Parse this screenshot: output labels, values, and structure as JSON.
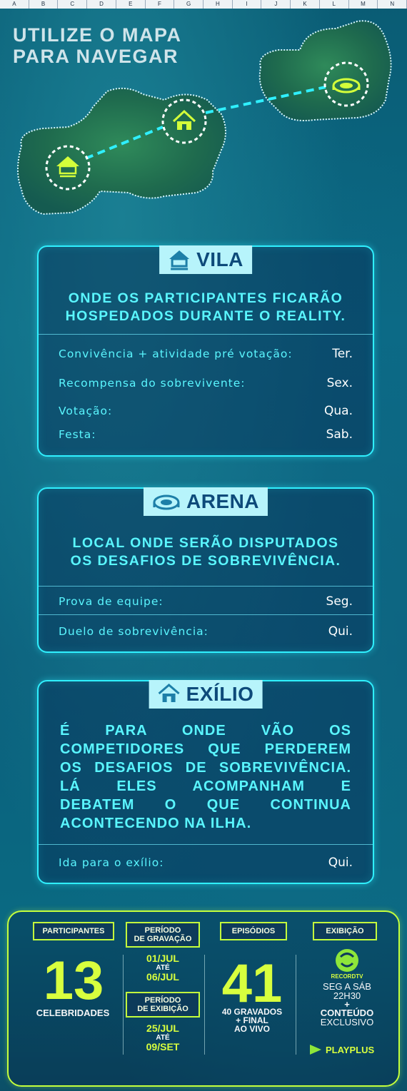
{
  "ruler": [
    "A",
    "B",
    "C",
    "D",
    "E",
    "F",
    "G",
    "H",
    "I",
    "J",
    "K",
    "L",
    "M",
    "N"
  ],
  "map_title": {
    "line1": "UTILIZE O MAPA",
    "line2": "PARA NAVEGAR"
  },
  "vila": {
    "tag": "VILA",
    "description": [
      "ONDE OS PARTICIPANTES FICARÃO",
      "HOSPEDADOS DURANTE O REALITY."
    ],
    "schedule": [
      {
        "label": "Convivência + atividade pré votação:",
        "day": "Ter."
      },
      {
        "label": "Recompensa do sobrevivente:",
        "day": "Sex."
      },
      {
        "label": "Votação:",
        "day": "Qua."
      },
      {
        "label": "Festa:",
        "day": "Sab."
      }
    ]
  },
  "arena": {
    "tag": "ARENA",
    "description": [
      "LOCAL ONDE SERÃO DISPUTADOS",
      "OS DESAFIOS DE SOBREVIVÊNCIA."
    ],
    "schedule": [
      {
        "label": "Prova de equipe:",
        "day": "Seg."
      },
      {
        "label": "Duelo de sobrevivência:",
        "day": "Qui."
      }
    ]
  },
  "exilio": {
    "tag": "EXÍLIO",
    "description": [
      "É PARA ONDE VÃO OS",
      "COMPETIDORES QUE PERDEREM",
      "OS DESAFIOS DE SOBREVIVÊNCIA.",
      "LÁ ELES ACOMPANHAM E",
      "DEBATEM O QUE CONTINUA",
      "ACONTECENDO NA ILHA."
    ],
    "schedule": [
      {
        "label": "Ida para o exílio:",
        "day": "Qui."
      }
    ]
  },
  "stats": {
    "participantes": {
      "badge": "PARTICIPANTES",
      "number": "13",
      "caption": "CELEBRIDADES"
    },
    "gravacao": {
      "badge_line1": "PERÍODO",
      "badge_line2": "DE GRAVAÇÃO",
      "start": "01/JUL",
      "ate": "ATÉ",
      "end": "06/JUL"
    },
    "exibicao_periodo": {
      "badge_line1": "PERÍODO",
      "badge_line2": "DE EXIBIÇÃO",
      "start": "25/JUL",
      "ate": "ATÉ",
      "end": "09/SET"
    },
    "episodios": {
      "badge": "EPISÓDIOS",
      "number": "41",
      "caption1": "40 GRAVADOS",
      "caption2": "+ FINAL",
      "caption3": "AO VIVO"
    },
    "exibicao": {
      "badge": "EXIBIÇÃO",
      "logo_text": "RECORDTV",
      "schedule1": "SEG A SÁB",
      "schedule2": "22H30",
      "plus": "+",
      "extra1": "CONTEÚDO",
      "extra2": "EXCLUSIVO",
      "platform": "PLAYPLUS"
    }
  },
  "colors": {
    "cyan": "#2ff0ff",
    "lime": "#c4ff3c",
    "tag_bg": "#b7f4fb",
    "tag_text": "#0d4a7a"
  }
}
